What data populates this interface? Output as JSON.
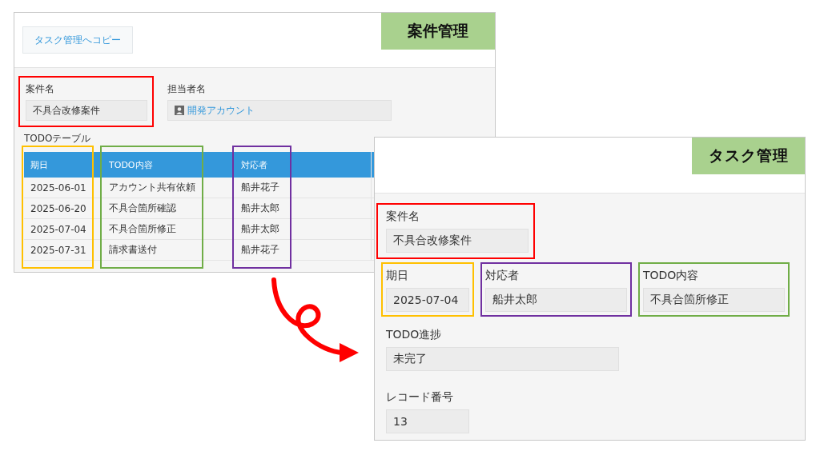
{
  "source_window": {
    "title": "案件管理",
    "copy_button": "タスク管理へコピー",
    "fields": [
      {
        "label": "案件名",
        "value": "不具合改修案件",
        "kind": "text",
        "color": "#ff0000"
      },
      {
        "label": "担当者名",
        "value": "開発アカウント",
        "kind": "user"
      }
    ],
    "table": {
      "title": "TODOテーブル",
      "columns": [
        {
          "label": "期日",
          "color": "#ffc000"
        },
        {
          "label": "TODO内容",
          "color": "#70ad47"
        },
        {
          "label": "対応者",
          "color": "#7030a0"
        }
      ],
      "rows": [
        [
          "2025-06-01",
          "アカウント共有依頼",
          "船井花子"
        ],
        [
          "2025-06-20",
          "不具合箇所確認",
          "船井太郎"
        ],
        [
          "2025-07-04",
          "不具合箇所修正",
          "船井太郎"
        ],
        [
          "2025-07-31",
          "請求書送付",
          "船井花子"
        ]
      ]
    }
  },
  "target_window": {
    "title": "タスク管理",
    "field_rows": [
      [
        {
          "label": "案件名",
          "value": "不具合改修案件",
          "color": "#ff0000"
        }
      ],
      [
        {
          "label": "期日",
          "value": "2025-07-04",
          "color": "#ffc000"
        },
        {
          "label": "対応者",
          "value": "船井太郎",
          "color": "#7030a0"
        },
        {
          "label": "TODO内容",
          "value": "不具合箇所修正",
          "color": "#70ad47"
        }
      ],
      [
        {
          "label": "TODO進捗",
          "value": "未完了"
        }
      ],
      [
        {
          "label": "レコード番号",
          "value": "13"
        }
      ]
    ]
  }
}
